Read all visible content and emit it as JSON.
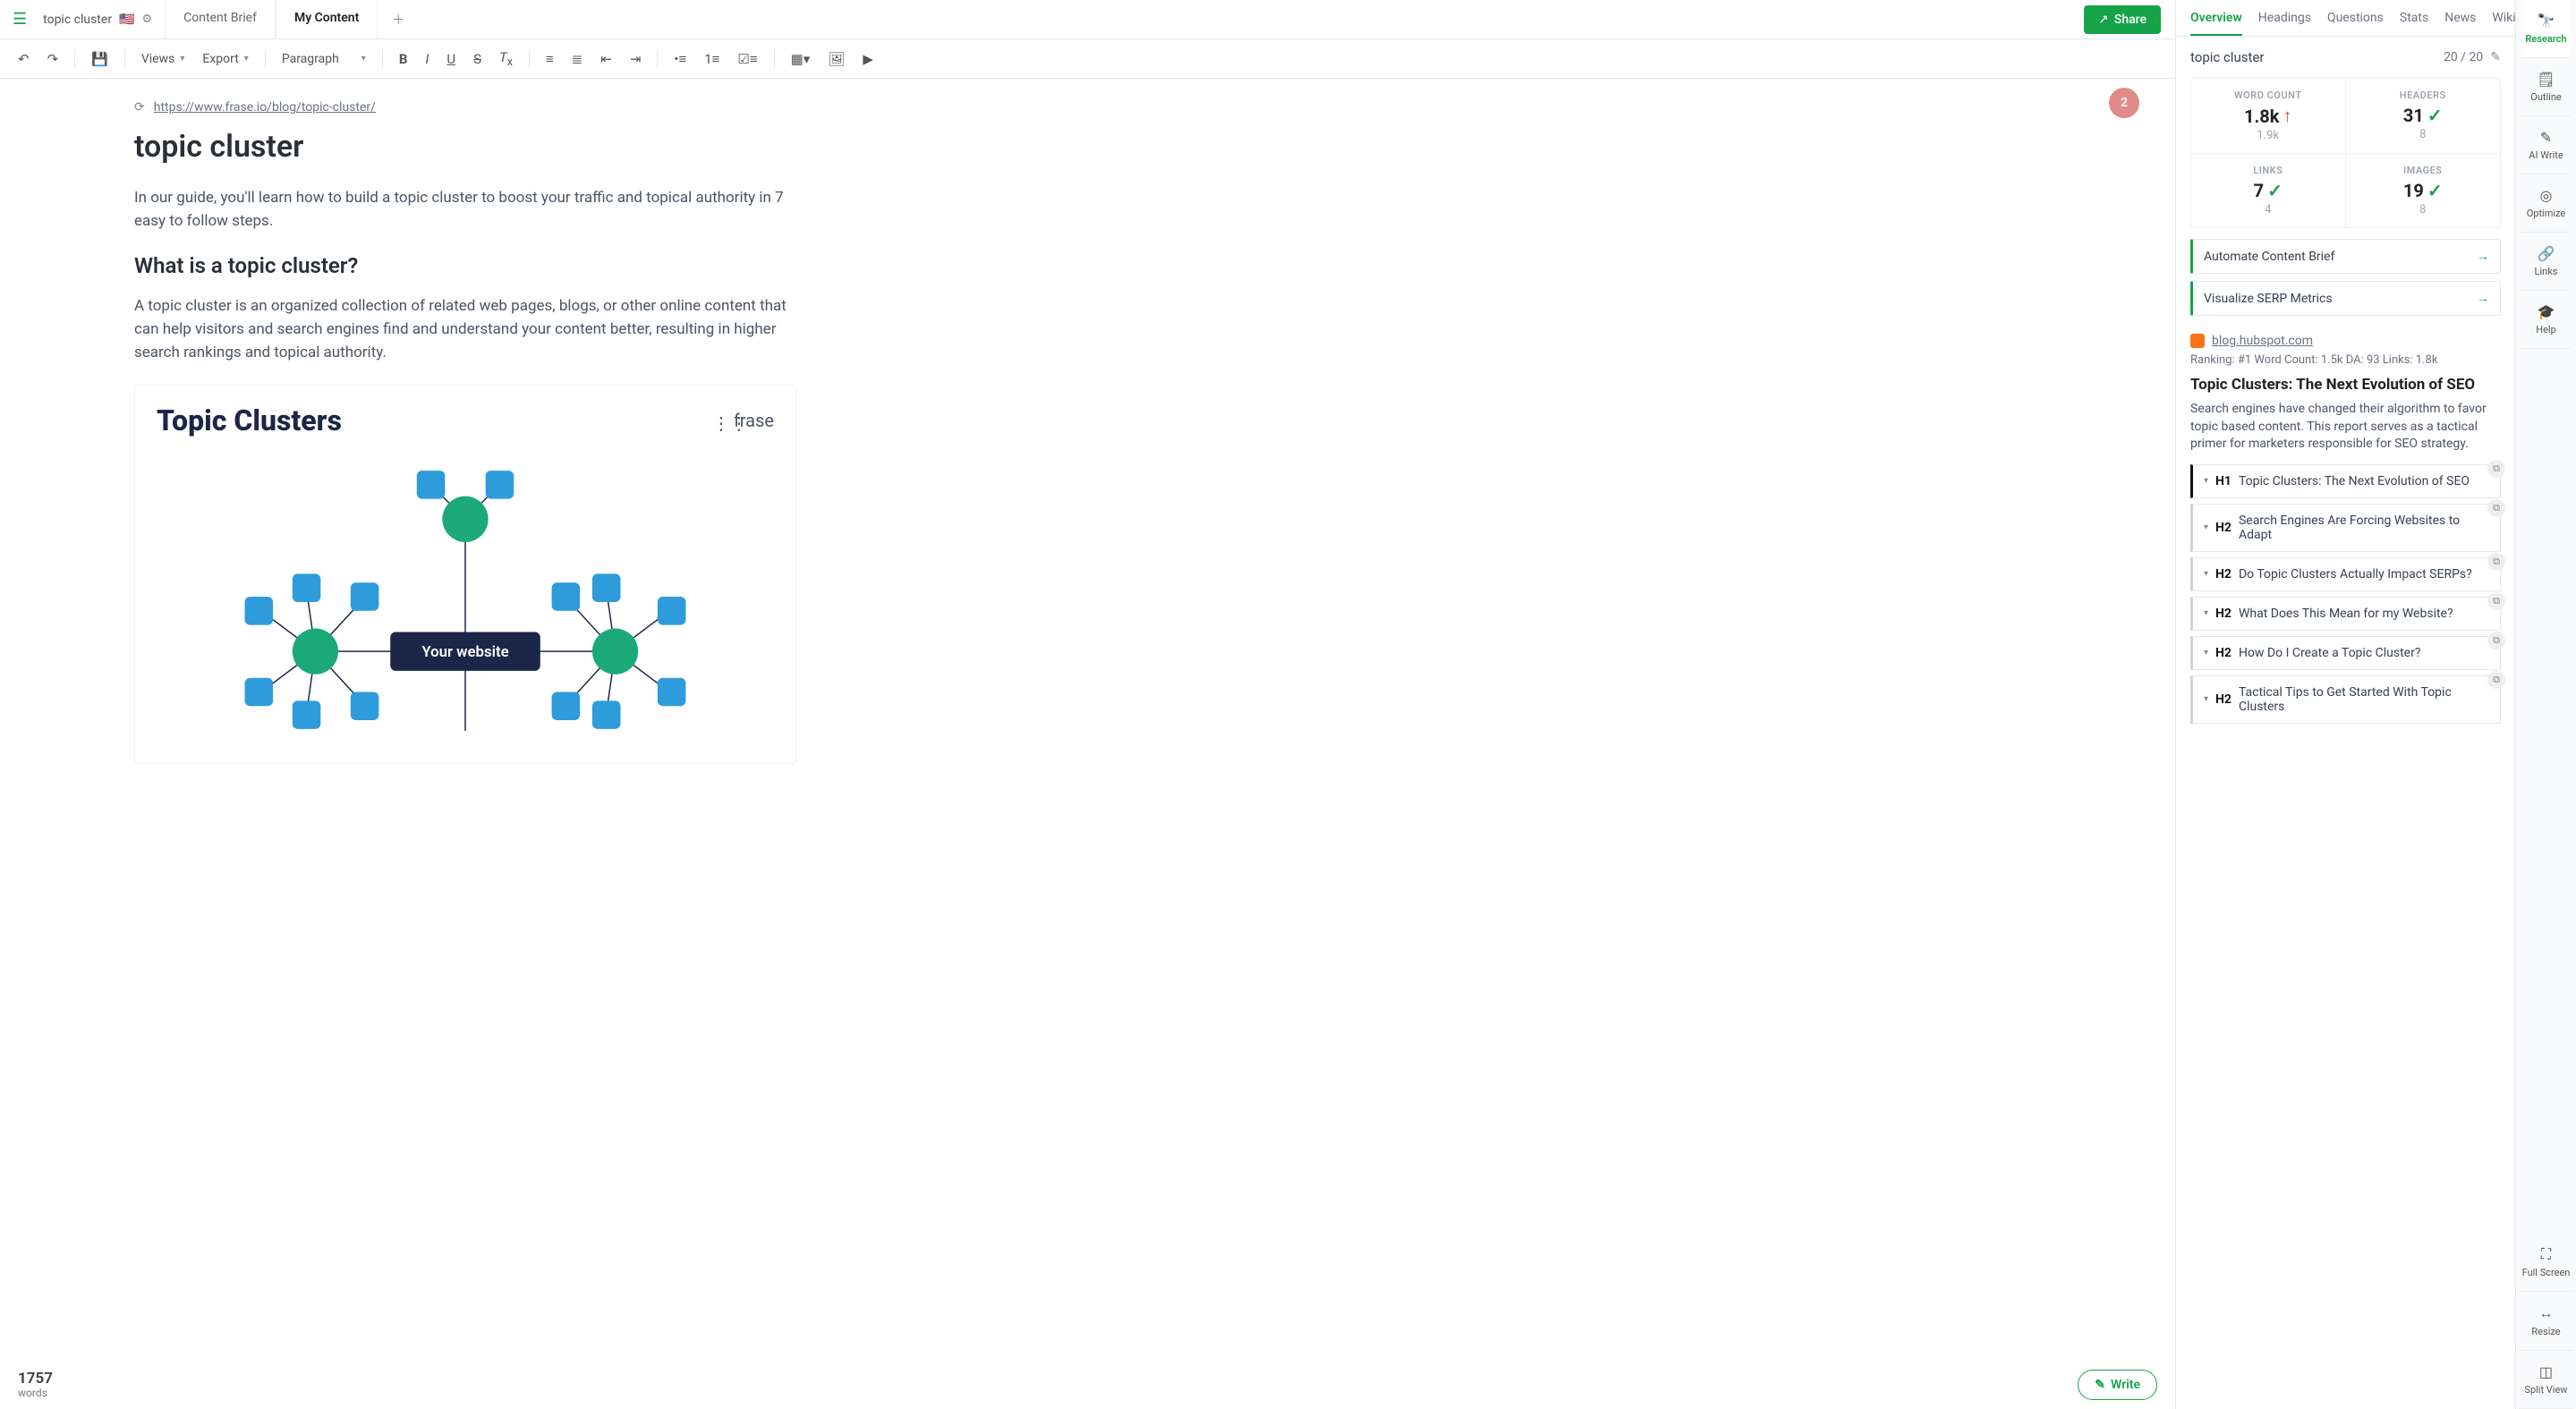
{
  "doc": {
    "name": "topic cluster",
    "flag": "🇺🇸",
    "tabs": [
      "Content Brief",
      "My Content"
    ],
    "active_tab": 1,
    "share_label": "Share"
  },
  "toolbar": {
    "views": "Views",
    "export": "Export",
    "paragraph": "Paragraph"
  },
  "page": {
    "url": "https://www.frase.io/blog/topic-cluster/",
    "badge": "2",
    "h1": "topic cluster",
    "p1": "In our guide, you'll learn how to build a topic cluster to boost your traffic and topical authority in 7 easy to follow steps.",
    "h2": "What is a topic cluster?",
    "p2": "A topic cluster is an organized collection of related web pages, blogs, or other online content that can help visitors and search engines find and understand your content better, resulting in higher search rankings and topical authority.",
    "diagram_title": "Topic Clusters",
    "diagram_brand": "frase",
    "diagram_center": "Your website"
  },
  "footer": {
    "words_num": "1757",
    "words_lbl": "words",
    "write_label": "Write"
  },
  "rp_tabs": [
    "Overview",
    "Headings",
    "Questions",
    "Stats",
    "News",
    "Wiki"
  ],
  "rp_active": 0,
  "overview": {
    "term": "topic cluster",
    "count": "20 / 20",
    "stats": [
      {
        "label": "WORD COUNT",
        "value": "1.8k",
        "trend": "up",
        "sub": "1.9k"
      },
      {
        "label": "HEADERS",
        "value": "31",
        "trend": "check",
        "sub": "8"
      },
      {
        "label": "LINKS",
        "value": "7",
        "trend": "check",
        "sub": "4"
      },
      {
        "label": "IMAGES",
        "value": "19",
        "trend": "check",
        "sub": "8"
      }
    ],
    "actions": [
      "Automate Content Brief",
      "Visualize SERP Metrics"
    ],
    "serp": {
      "source": "blog.hubspot.com",
      "meta": "Ranking: #1   Word Count: 1.5k   DA: 93   Links: 1.8k",
      "title": "Topic Clusters: The Next Evolution of SEO",
      "desc": "Search engines have changed their algorithm to favor topic based content. This report serves as a tactical primer for marketers responsible for SEO strategy.",
      "headings": [
        {
          "tag": "H1",
          "text": "Topic Clusters: The Next Evolution of SEO"
        },
        {
          "tag": "H2",
          "text": "Search Engines Are Forcing Websites to Adapt"
        },
        {
          "tag": "H2",
          "text": "Do Topic Clusters Actually Impact SERPs?"
        },
        {
          "tag": "H2",
          "text": "What Does This Mean for my Website?"
        },
        {
          "tag": "H2",
          "text": "How Do I Create a Topic Cluster?"
        },
        {
          "tag": "H2",
          "text": "Tactical Tips to Get Started With Topic Clusters"
        }
      ]
    }
  },
  "rail": [
    {
      "icon": "🔭",
      "label": "Research",
      "active": true
    },
    {
      "icon": "🗒",
      "label": "Outline"
    },
    {
      "icon": "✎",
      "label": "AI Write"
    },
    {
      "icon": "◎",
      "label": "Optimize"
    },
    {
      "icon": "🔗",
      "label": "Links"
    },
    {
      "icon": "🎓",
      "label": "Help"
    }
  ],
  "rail_bottom": [
    {
      "icon": "⛶",
      "label": "Full Screen"
    },
    {
      "icon": "↔",
      "label": "Resize"
    },
    {
      "icon": "◫",
      "label": "Split View"
    }
  ]
}
